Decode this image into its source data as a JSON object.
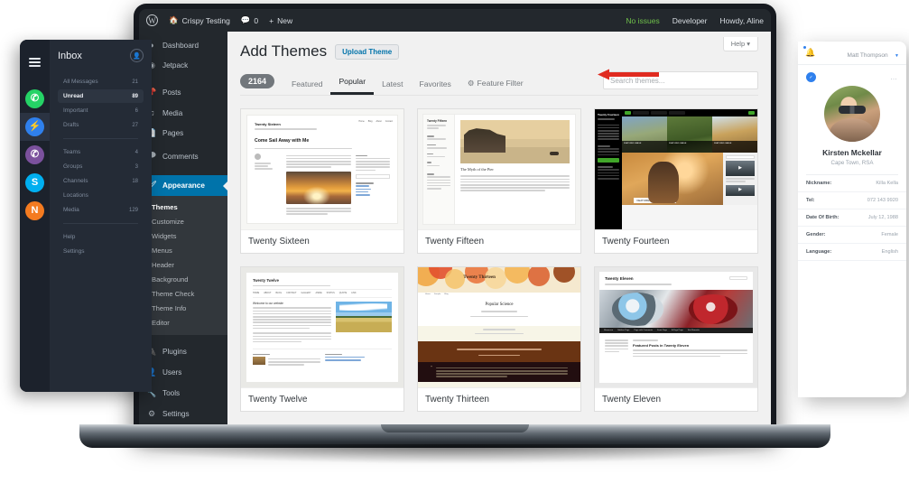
{
  "chat_panel": {
    "title": "Inbox",
    "menu_icon": "hamburger-icon",
    "add_contact_icon": "add-person-icon",
    "apps": [
      {
        "name": "whatsapp",
        "glyph": "✆",
        "color": "#25d366",
        "active": false
      },
      {
        "name": "messenger",
        "glyph": "⚡",
        "color": "#2f80ed",
        "active": true
      },
      {
        "name": "viber",
        "glyph": "✆",
        "color": "#7b519d",
        "active": false
      },
      {
        "name": "skype",
        "glyph": "S",
        "color": "#00aff0",
        "active": false
      },
      {
        "name": "nimbuzz",
        "glyph": "N",
        "color": "#f47b20",
        "active": false
      }
    ],
    "group_one": [
      {
        "label": "All Messages",
        "count": "21",
        "active": false
      },
      {
        "label": "Unread",
        "count": "89",
        "active": true
      },
      {
        "label": "Important",
        "count": "6",
        "active": false
      },
      {
        "label": "Drafts",
        "count": "27",
        "active": false
      }
    ],
    "group_two": [
      {
        "label": "Teams",
        "count": "4"
      },
      {
        "label": "Groups",
        "count": "3"
      },
      {
        "label": "Channels",
        "count": "18"
      },
      {
        "label": "Locations",
        "count": ""
      },
      {
        "label": "Media",
        "count": "129"
      }
    ],
    "group_three": [
      {
        "label": "Help",
        "count": ""
      },
      {
        "label": "Settings",
        "count": ""
      }
    ]
  },
  "contact_panel": {
    "bell_icon": "bell-icon",
    "account_name": "Matt Thompson",
    "more_icon": "more-options-icon",
    "status_badge": "✓",
    "name": "Kirsten Mckellar",
    "location": "Cape Town, RSA",
    "fields": [
      {
        "key": "Nickname:",
        "value": "Killa Kella"
      },
      {
        "key": "Tel:",
        "value": "072 143 9920"
      },
      {
        "key": "Date Of Birth:",
        "value": "July 12, 1988"
      },
      {
        "key": "Gender:",
        "value": "Female"
      },
      {
        "key": "Language:",
        "value": "English"
      }
    ]
  },
  "adminbar": {
    "logo_icon": "wordpress-logo-icon",
    "home_icon": "home-icon",
    "site_name": "Crispy Testing",
    "comments_icon": "comment-bubble-icon",
    "comments_count": "0",
    "new_icon": "plus-icon",
    "new_label": "New",
    "no_issues": "No issues",
    "developer": "Developer",
    "howdy": "Howdy, Aline"
  },
  "sidebar": {
    "items": [
      {
        "label": "Dashboard",
        "icon": "◔",
        "icon_name": "dashboard-icon",
        "current": false
      },
      {
        "label": "Jetpack",
        "icon": "◉",
        "icon_name": "jetpack-icon",
        "current": false
      },
      {
        "label": "Posts",
        "icon": "✎",
        "icon_name": "pin-icon",
        "current": false
      },
      {
        "label": "Media",
        "icon": "♫",
        "icon_name": "media-icon",
        "current": false
      },
      {
        "label": "Pages",
        "icon": "❐",
        "icon_name": "pages-icon",
        "current": false
      },
      {
        "label": "Comments",
        "icon": "⌨",
        "icon_name": "comments-icon",
        "current": false
      },
      {
        "label": "Appearance",
        "icon": "✎",
        "icon_name": "appearance-brush-icon",
        "current": true
      }
    ],
    "submenu": [
      {
        "label": "Themes",
        "current": true
      },
      {
        "label": "Customize",
        "current": false
      },
      {
        "label": "Widgets",
        "current": false
      },
      {
        "label": "Menus",
        "current": false
      },
      {
        "label": "Header",
        "current": false
      },
      {
        "label": "Background",
        "current": false
      },
      {
        "label": "Theme Check",
        "current": false
      },
      {
        "label": "Theme Info",
        "current": false
      },
      {
        "label": "Editor",
        "current": false
      }
    ],
    "items_bottom": [
      {
        "label": "Plugins",
        "icon": "⚒",
        "icon_name": "plugins-icon"
      },
      {
        "label": "Users",
        "icon": "♟",
        "icon_name": "users-icon"
      },
      {
        "label": "Tools",
        "icon": "⚒",
        "icon_name": "tools-wrench-icon"
      },
      {
        "label": "Settings",
        "icon": "⚙",
        "icon_name": "settings-gear-icon"
      }
    ]
  },
  "content": {
    "page_title": "Add Themes",
    "upload_button": "Upload Theme",
    "help_tab": "Help",
    "help_caret": "▾",
    "arrow_icon": "red-arrow-pointing-left",
    "arrow_color": "#e02b20",
    "theme_count": "2164",
    "tabs": [
      {
        "label": "Featured",
        "active": false
      },
      {
        "label": "Popular",
        "active": true
      },
      {
        "label": "Latest",
        "active": false
      },
      {
        "label": "Favorites",
        "active": false
      }
    ],
    "feature_filter": "Feature Filter",
    "feature_filter_icon": "gear-icon",
    "search_placeholder": "Search themes...",
    "themes": [
      {
        "name": "Twenty Sixteen",
        "post_title": "Come Sail Away with Me",
        "site_title": "Twenty Sixteen"
      },
      {
        "name": "Twenty Fifteen",
        "post_title": "The Myth of the Pier",
        "site_title": "Twenty Fifteen"
      },
      {
        "name": "Twenty Fourteen",
        "post_title": "FEATURED IMAGES REALLY",
        "site_title": "Twenty Fourteen"
      },
      {
        "name": "Twenty Twelve",
        "post_title": "Welcome to our website",
        "site_title": "Twenty Twelve"
      },
      {
        "name": "Twenty Thirteen",
        "post_title": "Popular Science",
        "site_title": "Twenty Thirteen"
      },
      {
        "name": "Twenty Eleven",
        "post_title": "Featured Posts in Twenty Eleven",
        "site_title": "Twenty Eleven"
      }
    ]
  }
}
